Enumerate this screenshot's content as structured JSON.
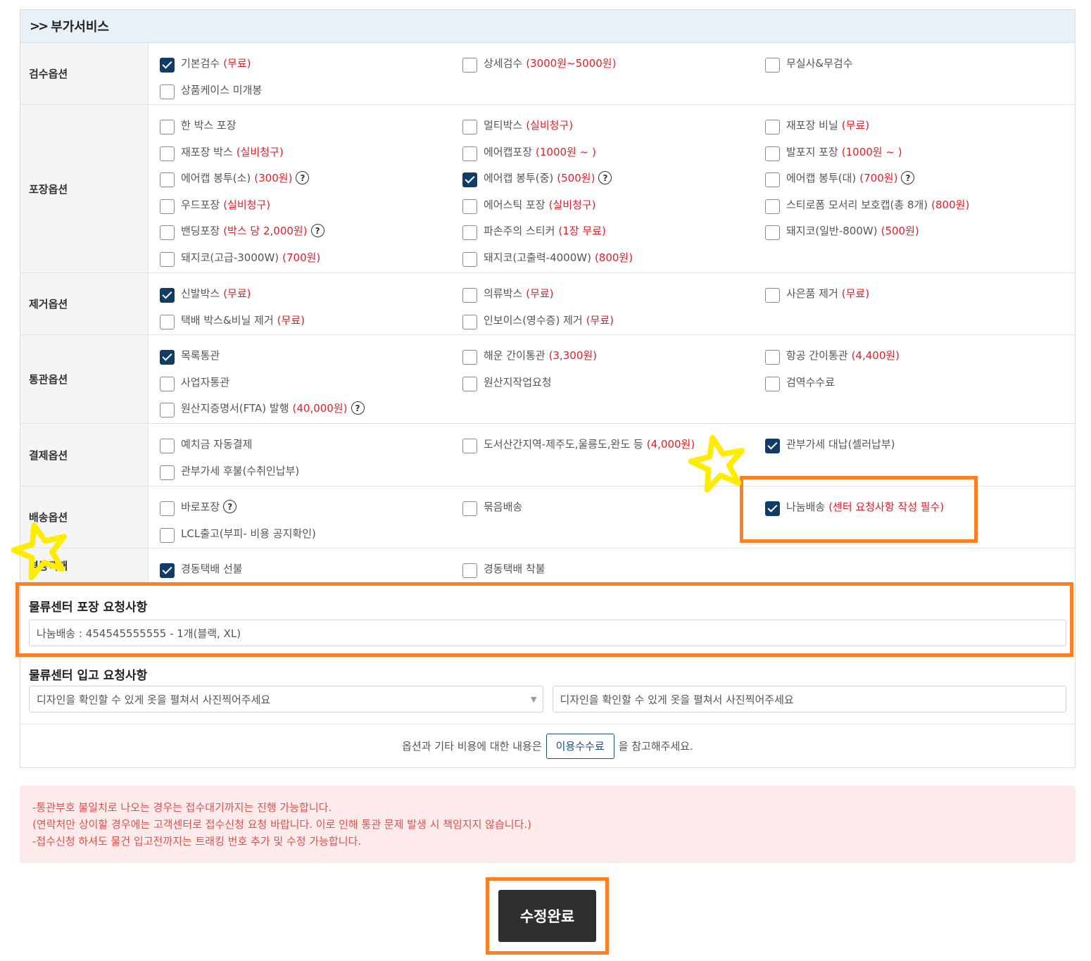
{
  "section_title": "부가서비스",
  "rows": [
    {
      "label": "검수옵션",
      "items": [
        {
          "text": "기본검수",
          "note": "(무료)",
          "checked": true
        },
        {
          "text": "상세검수",
          "note": "(3000원~5000원)",
          "checked": false
        },
        {
          "text": "무실사&무검수",
          "note": "",
          "checked": false
        },
        {
          "text": "상품케이스 미개봉",
          "note": "",
          "checked": false
        }
      ]
    },
    {
      "label": "포장옵션",
      "items": [
        {
          "text": "한 박스 포장",
          "note": "",
          "checked": false
        },
        {
          "text": "멀티박스",
          "note": "(실비청구)",
          "checked": false
        },
        {
          "text": "재포장 비닐",
          "note": "(무료)",
          "checked": false
        },
        {
          "text": "재포장 박스",
          "note": "(실비청구)",
          "checked": false
        },
        {
          "text": "에어캡포장",
          "note": "(1000원 ~ )",
          "checked": false
        },
        {
          "text": "발포지 포장",
          "note": "(1000원 ~ )",
          "checked": false
        },
        {
          "text": "에어캡 봉투(소)",
          "note": "(300원)",
          "checked": false,
          "help": true
        },
        {
          "text": "에어캡 봉투(중)",
          "note": "(500원)",
          "checked": true,
          "help": true
        },
        {
          "text": "에어캡 봉투(대)",
          "note": "(700원)",
          "checked": false,
          "help": true
        },
        {
          "text": "우드포장",
          "note": "(실비청구)",
          "checked": false
        },
        {
          "text": "에어스틱 포장",
          "note": "(실비청구)",
          "checked": false
        },
        {
          "text": "스티로폼 모서리 보호캡(총 8개)",
          "note": "(800원)",
          "checked": false
        },
        {
          "text": "밴딩포장",
          "note": "(박스 당 2,000원)",
          "checked": false,
          "help": true
        },
        {
          "text": "파손주의 스티커",
          "note": "(1장 무료)",
          "checked": false
        },
        {
          "text": "돼지코(일반-800W)",
          "note": "(500원)",
          "checked": false
        },
        {
          "text": "돼지코(고급-3000W)",
          "note": "(700원)",
          "checked": false
        },
        {
          "text": "돼지코(고출력-4000W)",
          "note": "(800원)",
          "checked": false
        }
      ]
    },
    {
      "label": "제거옵션",
      "items": [
        {
          "text": "신발박스",
          "note": "(무료)",
          "checked": true
        },
        {
          "text": "의류박스",
          "note": "(무료)",
          "checked": false
        },
        {
          "text": "사은품 제거",
          "note": "(무료)",
          "checked": false
        },
        {
          "text": "택배 박스&비닐 제거",
          "note": "(무료)",
          "checked": false
        },
        {
          "text": "인보이스(영수증) 제거",
          "note": "(무료)",
          "checked": false
        }
      ]
    },
    {
      "label": "통관옵션",
      "items": [
        {
          "text": "목록통관",
          "note": "",
          "checked": true
        },
        {
          "text": "해운 간이통관",
          "note": "(3,300원)",
          "checked": false
        },
        {
          "text": "항공 간이통관",
          "note": "(4,400원)",
          "checked": false
        },
        {
          "text": "사업자통관",
          "note": "",
          "checked": false
        },
        {
          "text": "원산지작업요청",
          "note": "",
          "checked": false
        },
        {
          "text": "검역수수료",
          "note": "",
          "checked": false
        },
        {
          "text": "원산지증명서(FTA) 발행",
          "note": "(40,000원)",
          "checked": false,
          "help": true
        }
      ]
    },
    {
      "label": "결제옵션",
      "items": [
        {
          "text": "예치금 자동결제",
          "note": "",
          "checked": false
        },
        {
          "text": "도서산간지역-제주도,울릉도,완도 등",
          "note": "(4,000원)",
          "checked": false
        },
        {
          "text": "관부가세 대납(셀러납부)",
          "note": "",
          "checked": true
        },
        {
          "text": "관부가세 후불(수취인납부)",
          "note": "",
          "checked": false
        }
      ]
    },
    {
      "label": "배송옵션",
      "items": [
        {
          "text": "바로포장",
          "note": "",
          "checked": false,
          "help": true
        },
        {
          "text": "묶음배송",
          "note": "",
          "checked": false
        },
        {
          "text": "나눔배송",
          "note": "(센터 요청사항 작성 필수)",
          "checked": true
        },
        {
          "text": "LCL출고(부피- 비용 공지확인)",
          "note": "",
          "checked": false
        }
      ]
    },
    {
      "label": "경동택배",
      "items": [
        {
          "text": "경동택배 선불",
          "note": "",
          "checked": true
        },
        {
          "text": "경동택배 착불",
          "note": "",
          "checked": false
        }
      ]
    }
  ],
  "packing_request": {
    "title": "물류센터 포장 요청사항",
    "value": "나눔배송 : 454545555555 - 1개(블랙, XL)"
  },
  "inbound_request": {
    "title": "물류센터 입고 요청사항",
    "select_value": "디자인을 확인할 수 있게 옷을 펼쳐서 사진찍어주세요",
    "input_value": "디자인을 확인할 수 있게 옷을 펼쳐서 사진찍어주세요"
  },
  "fee_line": {
    "before": "옵션과 기타 비용에 대한 내용은",
    "button": "이용수수료",
    "after": "을 참고해주세요."
  },
  "notice": [
    "-통관부호 불일치로 나오는 경우는 접수대기까지는 진행 가능합니다.",
    "(연락처만 상이할 경우에는 고객센터로 접수신청 요청 바랍니다. 이로 인해 통관 문제 발생 시 책임지지 않습니다.)",
    "-접수신청 하셔도 물건 입고전까지는 트래킹 번호 추가 및 수정 가능합니다."
  ],
  "submit_label": "수정완료",
  "colors": {
    "accent": "#0f3d67",
    "highlight": "#ff7f24",
    "price_red": "#e0202a",
    "star": "#ffec00"
  }
}
